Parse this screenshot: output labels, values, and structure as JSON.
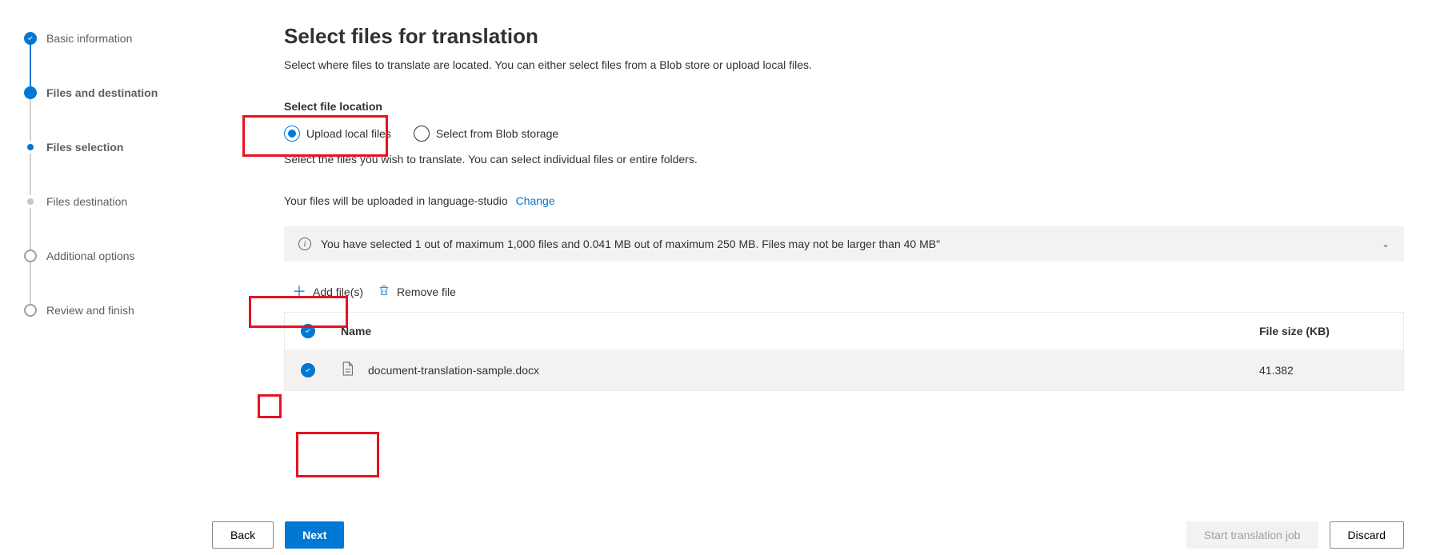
{
  "stepper": {
    "steps": [
      {
        "label": "Basic information"
      },
      {
        "label": "Files and destination"
      },
      {
        "label": "Files selection"
      },
      {
        "label": "Files destination"
      },
      {
        "label": "Additional options"
      },
      {
        "label": "Review and finish"
      }
    ]
  },
  "main": {
    "title": "Select files for translation",
    "subtitle": "Select where files to translate are located. You can either select files from a Blob store or upload local files.",
    "section_label": "Select file location",
    "radio_upload": "Upload local files",
    "radio_blob": "Select from Blob storage",
    "helper": "Select the files you wish to translate. You can select individual files or entire folders.",
    "upload_prefix": "Your files will be uploaded in language-studio",
    "change": "Change",
    "banner": "You have selected 1 out of maximum 1,000 files and 0.041 MB out of maximum 250 MB. Files may not be larger than 40 MB\"",
    "add_files": "Add file(s)",
    "remove_file": "Remove file",
    "col_name": "Name",
    "col_size": "File size (KB)",
    "rows": [
      {
        "name": "document-translation-sample.docx",
        "size": "41.382"
      }
    ]
  },
  "footer": {
    "back": "Back",
    "next": "Next",
    "start": "Start translation job",
    "discard": "Discard"
  }
}
